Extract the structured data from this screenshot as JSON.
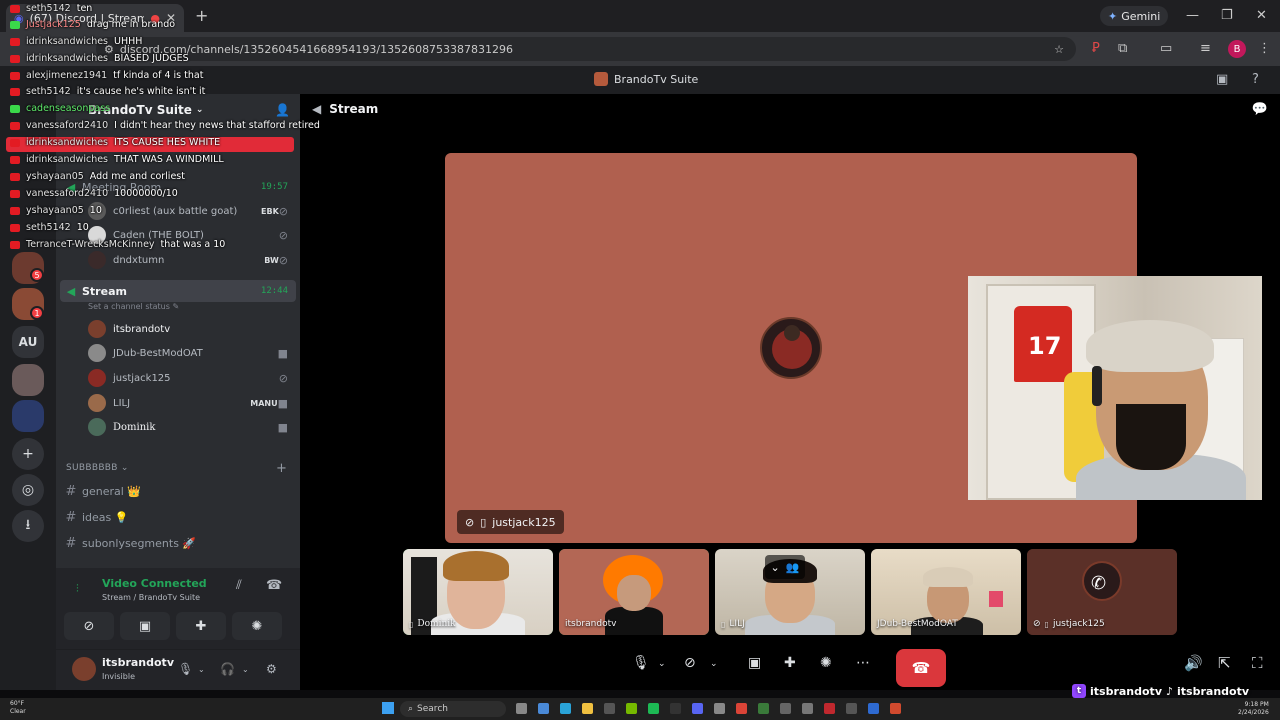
{
  "browser": {
    "tab_title": "(67) Discord | Stream | Bran",
    "url": "discord.com/channels/1352604541668954193/1352608753387831296",
    "gemini_label": "Gemini"
  },
  "app": {
    "window_title": "BrandoTv Suite"
  },
  "server": {
    "name": "BrandoTv Suite",
    "rail_text_au": "AU",
    "badges": [
      "5",
      "1",
      "1"
    ]
  },
  "voice_channels": [
    {
      "name": "Meeting Room",
      "time": "19:57",
      "members": [
        {
          "name": "c0rliest (aux battle goat)",
          "tag": "EBK"
        },
        {
          "name": "Caden (THE BOLT)",
          "tag": ""
        },
        {
          "name": "dndxtumn",
          "tag": "BW"
        }
      ]
    },
    {
      "name": "Stream",
      "time": "12:44",
      "status": "Set a channel status",
      "members": [
        {
          "name": "itsbrandotv",
          "tag": ""
        },
        {
          "name": "JDub-BestModOAT",
          "tag": ""
        },
        {
          "name": "justjack125",
          "tag": ""
        },
        {
          "name": "LILJ",
          "tag": "MANU"
        },
        {
          "name": "Dominik",
          "tag": ""
        }
      ]
    }
  ],
  "category": {
    "name": "SUBBBBBB",
    "channels": [
      "general 👑",
      "ideas 💡",
      "subonlysegments 🚀"
    ]
  },
  "voice_status": {
    "title": "Video Connected",
    "subtitle": "Stream / BrandoTv Suite"
  },
  "user": {
    "name": "itsbrandotv",
    "status": "Invisible"
  },
  "stage": {
    "header": "Stream",
    "main_name": "justjack125",
    "thumbnails": [
      "Dominik",
      "itsbrandotv",
      "LILJ",
      "JDub-BestModOAT",
      "justjack125"
    ],
    "jersey_number": "17"
  },
  "chat": [
    {
      "user": "seth5142",
      "msg": "ten",
      "src": "yt"
    },
    {
      "user": "Justjack125",
      "msg": "drag me in brando",
      "src": "kick"
    },
    {
      "user": "idrinksandwiches",
      "msg": "UHHH",
      "src": "yt"
    },
    {
      "user": "idrinksandwiches",
      "msg": "BIASED JUDGES",
      "src": "yt"
    },
    {
      "user": "alexjimenez1941",
      "msg": "tf kinda of 4 is that",
      "src": "yt"
    },
    {
      "user": "seth5142",
      "msg": "it's cause he's white isn't it",
      "src": "yt"
    },
    {
      "user": "cadenseasonpass",
      "msg": "",
      "src": "kick"
    },
    {
      "user": "vanessaford2410",
      "msg": "I didn't hear they news that stafford retired",
      "src": "yt"
    },
    {
      "user": "idrinksandwiches",
      "msg": "ITS CAUSE HES WHITE",
      "src": "yt"
    },
    {
      "user": "idrinksandwiches",
      "msg": "THAT WAS A WINDMILL",
      "src": "yt"
    },
    {
      "user": "yshayaan05",
      "msg": "Add me and corliest",
      "src": "yt"
    },
    {
      "user": "vanessaford2410",
      "msg": "10000000/10",
      "src": "yt"
    },
    {
      "user": "yshayaan05",
      "msg": "10",
      "src": "yt"
    },
    {
      "user": "seth5142",
      "msg": "10",
      "src": "yt"
    },
    {
      "user": "TerranceT-WrecksMcKinney",
      "msg": "that was a 10",
      "src": "yt"
    }
  ],
  "taskbar": {
    "search": "Search",
    "weather_temp": "60°F",
    "weather_desc": "Clear",
    "time": "9:18 PM",
    "date": "2/24/2026"
  },
  "overlay": {
    "handle1": "itsbrandotv",
    "handle2": "itsbrandotv"
  },
  "colors": {
    "accent_green": "#23a559",
    "hangup_red": "#da373c",
    "tile_bg": "#b0604f"
  }
}
